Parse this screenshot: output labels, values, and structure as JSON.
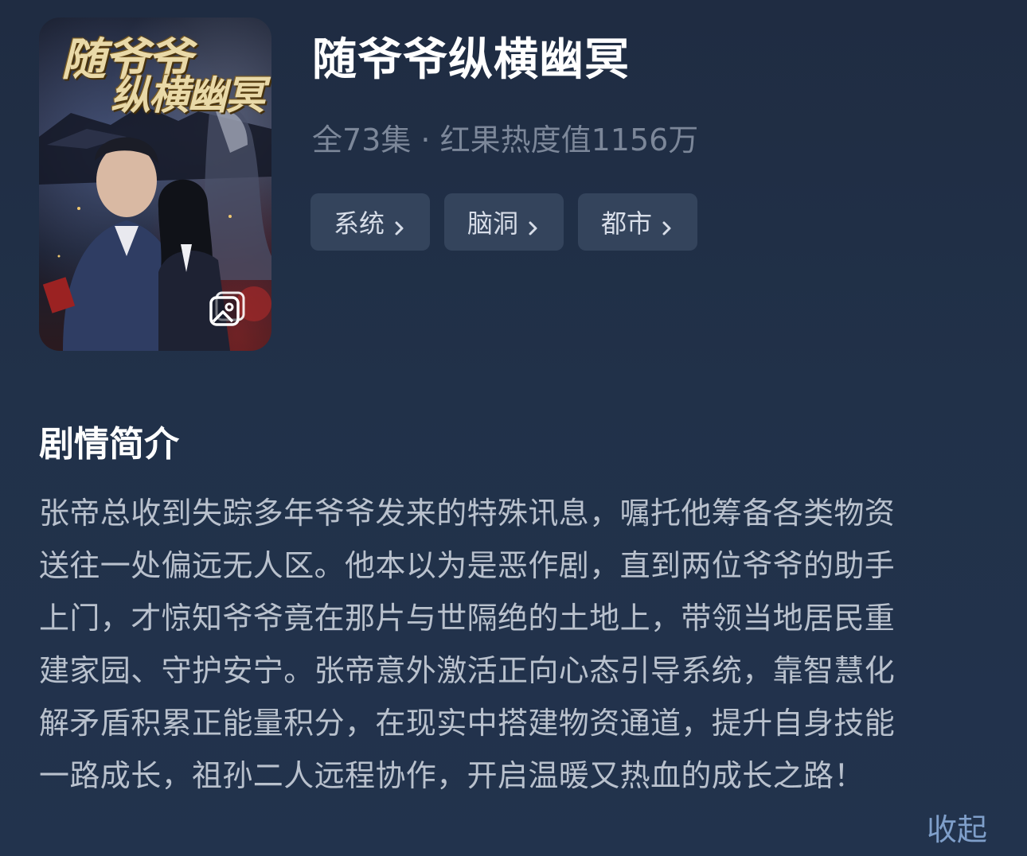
{
  "drama": {
    "title": "随爷爷纵横幽冥",
    "meta": "全73集 · 红果热度值1156万",
    "cover": {
      "title_line1": "随爷爷",
      "title_line2": "纵横幽冥",
      "gallery_icon": "gallery-icon"
    },
    "tags": [
      {
        "label": "系统"
      },
      {
        "label": "脑洞"
      },
      {
        "label": "都市"
      }
    ]
  },
  "synopsis": {
    "heading": "剧情简介",
    "lines": [
      "张帝总收到失踪多年爷爷发来的特殊讯息，嘱托他筹备各类物资",
      "送往一处偏远无人区。他本以为是恶作剧，直到两位爷爷的助手",
      "上门，才惊知爷爷竟在那片与世隔绝的土地上，带领当地居民重",
      "建家园、守护安宁。张帝意外激活正向心态引导系统，靠智慧化",
      "解矛盾积累正能量积分，在现实中搭建物资通道，提升自身技能",
      "一路成长，祖孙二人远程协作，开启温暖又热血的成长之路！"
    ],
    "collapse_label": "收起"
  },
  "colors": {
    "background": "#213149",
    "tag_bg": "#34445c",
    "meta_text": "#7c8799",
    "link": "#7f9fca"
  }
}
